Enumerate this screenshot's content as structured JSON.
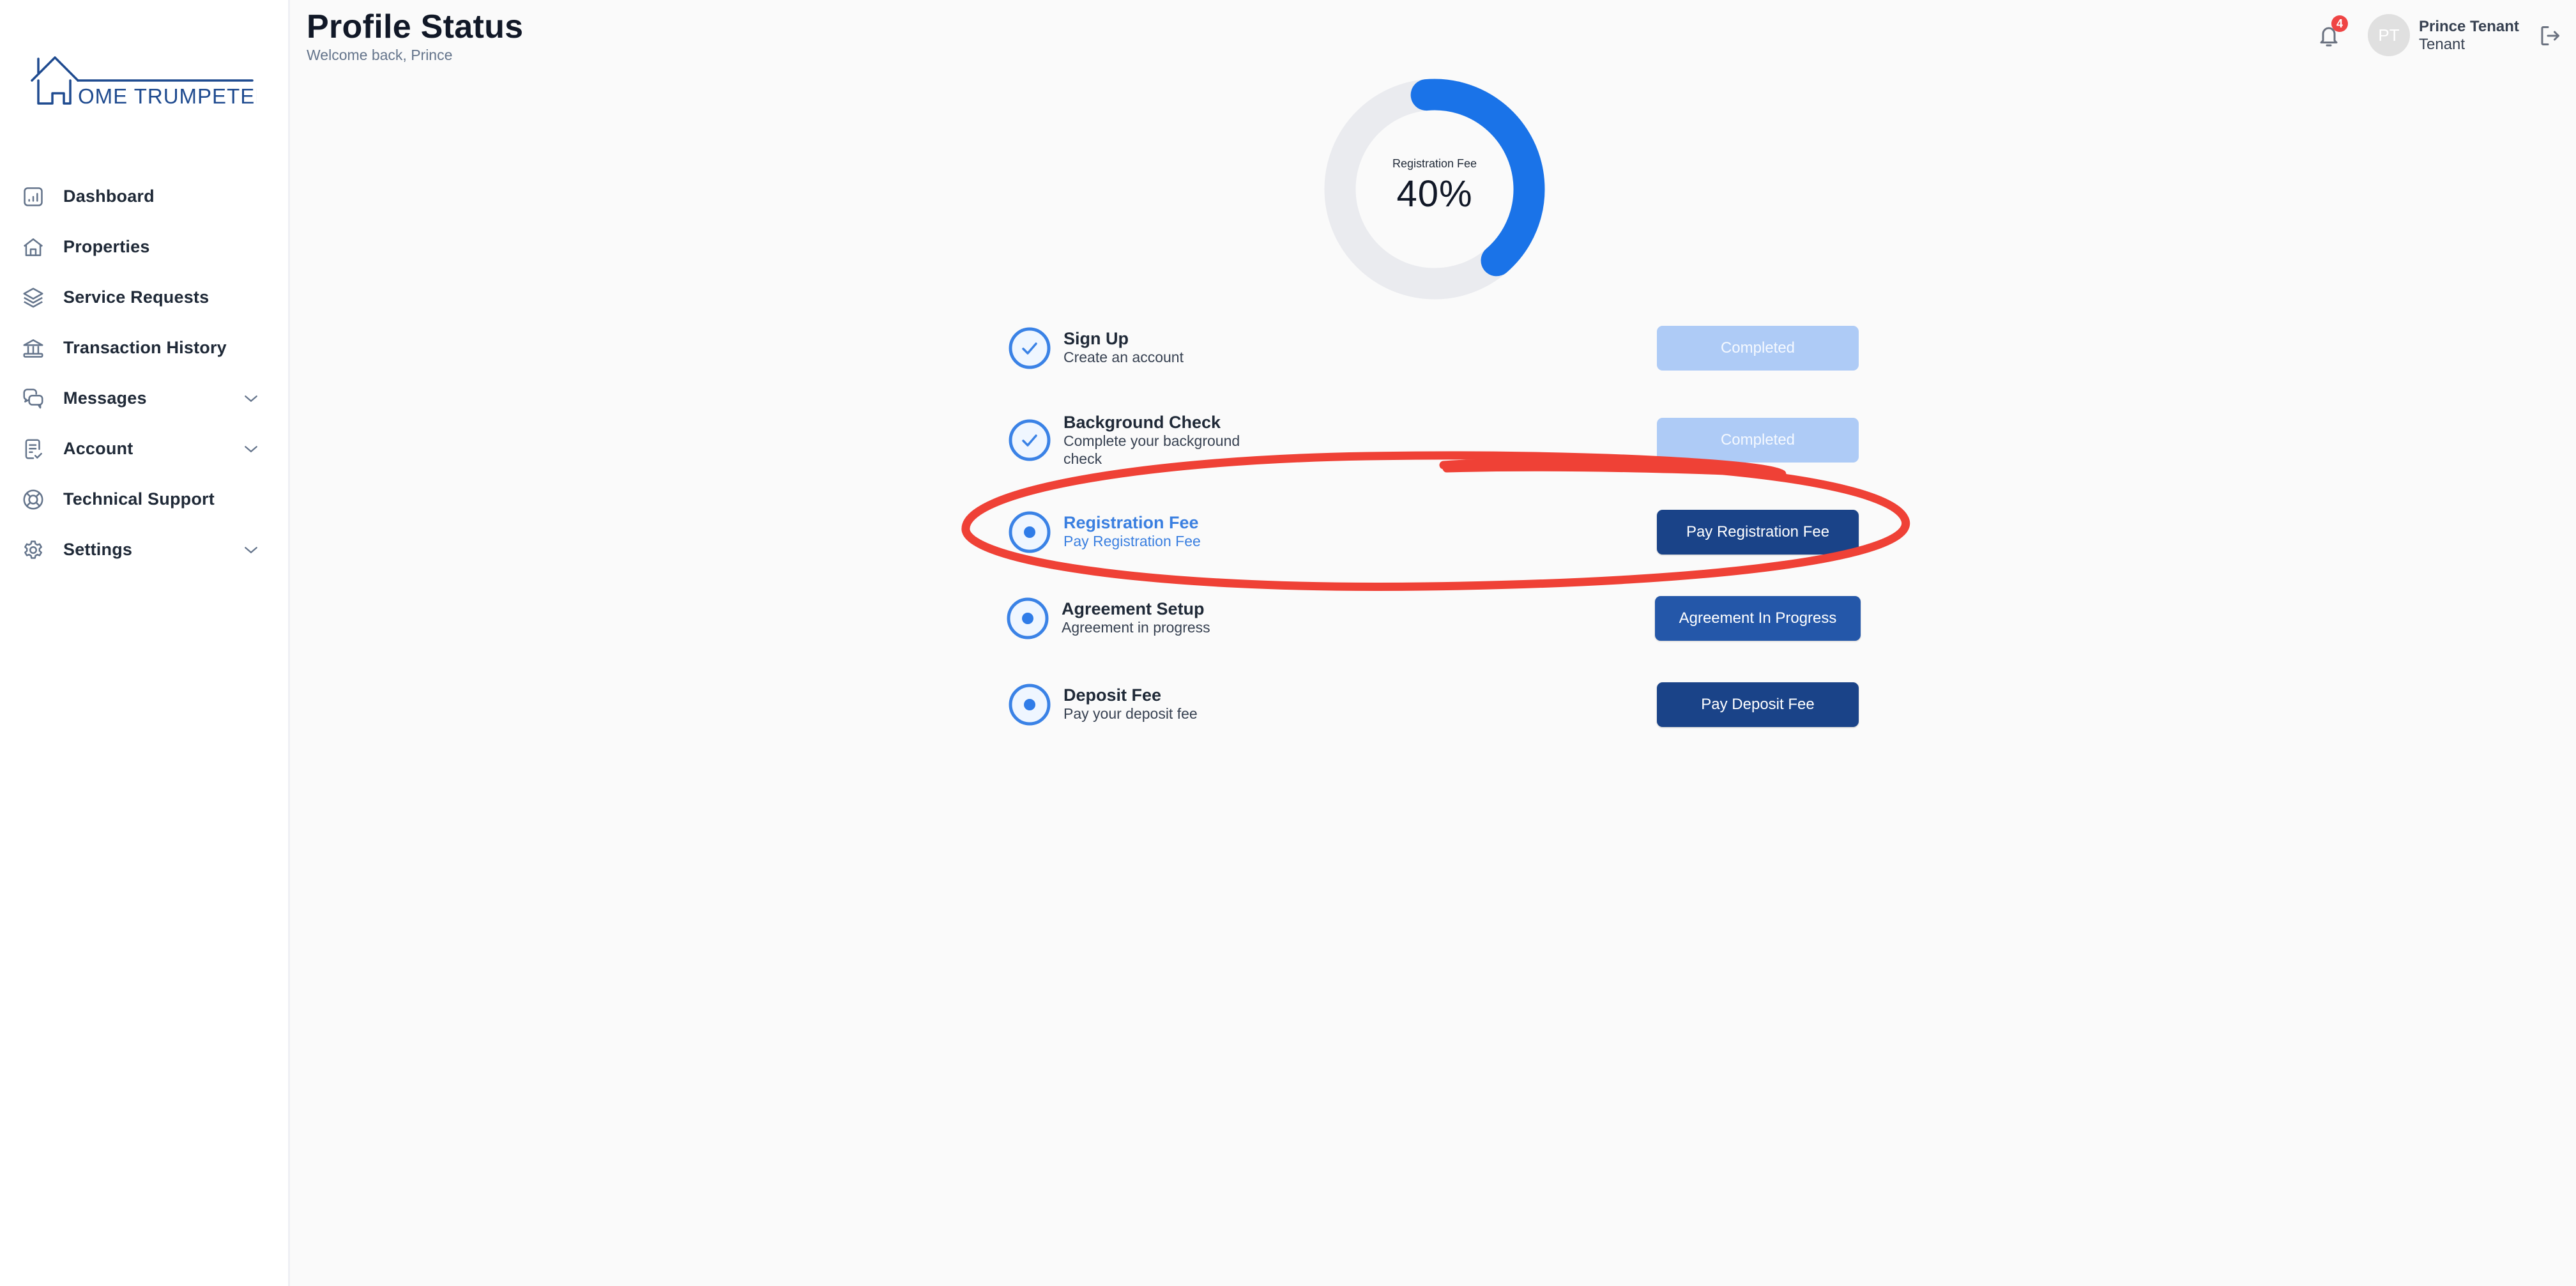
{
  "brand": {
    "logo_text": "OME TRUMPETER",
    "logo_color": "#1e4a8f"
  },
  "sidebar": {
    "items": [
      {
        "label": "Dashboard",
        "icon": "chart-bar-icon",
        "has_chevron": false
      },
      {
        "label": "Properties",
        "icon": "home-icon",
        "has_chevron": false
      },
      {
        "label": "Service Requests",
        "icon": "layers-icon",
        "has_chevron": false
      },
      {
        "label": "Transaction History",
        "icon": "bank-icon",
        "has_chevron": false
      },
      {
        "label": "Messages",
        "icon": "chat-bubbles-icon",
        "has_chevron": true
      },
      {
        "label": "Account",
        "icon": "document-check-icon",
        "has_chevron": true
      },
      {
        "label": "Technical Support",
        "icon": "lifebuoy-icon",
        "has_chevron": false
      },
      {
        "label": "Settings",
        "icon": "gear-icon",
        "has_chevron": true
      }
    ]
  },
  "header": {
    "title": "Profile Status",
    "subtitle": "Welcome back, Prince",
    "notifications_count": "4",
    "user": {
      "initials": "PT",
      "name": "Prince Tenant",
      "role": "Tenant"
    }
  },
  "progress": {
    "label": "Registration Fee",
    "value_text": "40%",
    "percent": 40,
    "color": "#1a73e8",
    "track_color": "#eaebef"
  },
  "steps": [
    {
      "title": "Sign Up",
      "description": "Create an account",
      "status": "completed",
      "button": "Completed"
    },
    {
      "title": "Background Check",
      "description": "Complete your background check",
      "status": "completed",
      "button": "Completed"
    },
    {
      "title": "Registration Fee",
      "description": "Pay Registration Fee",
      "status": "active",
      "button": "Pay Registration Fee"
    },
    {
      "title": "Agreement Setup",
      "description": "Agreement in progress",
      "status": "pending",
      "button": "Agreement In Progress"
    },
    {
      "title": "Deposit Fee",
      "description": "Pay your deposit fee",
      "status": "pending",
      "button": "Pay Deposit Fee"
    }
  ],
  "colors": {
    "accent": "#3a82e6",
    "annotation": "#ef4136",
    "badge": "#ef4444"
  }
}
